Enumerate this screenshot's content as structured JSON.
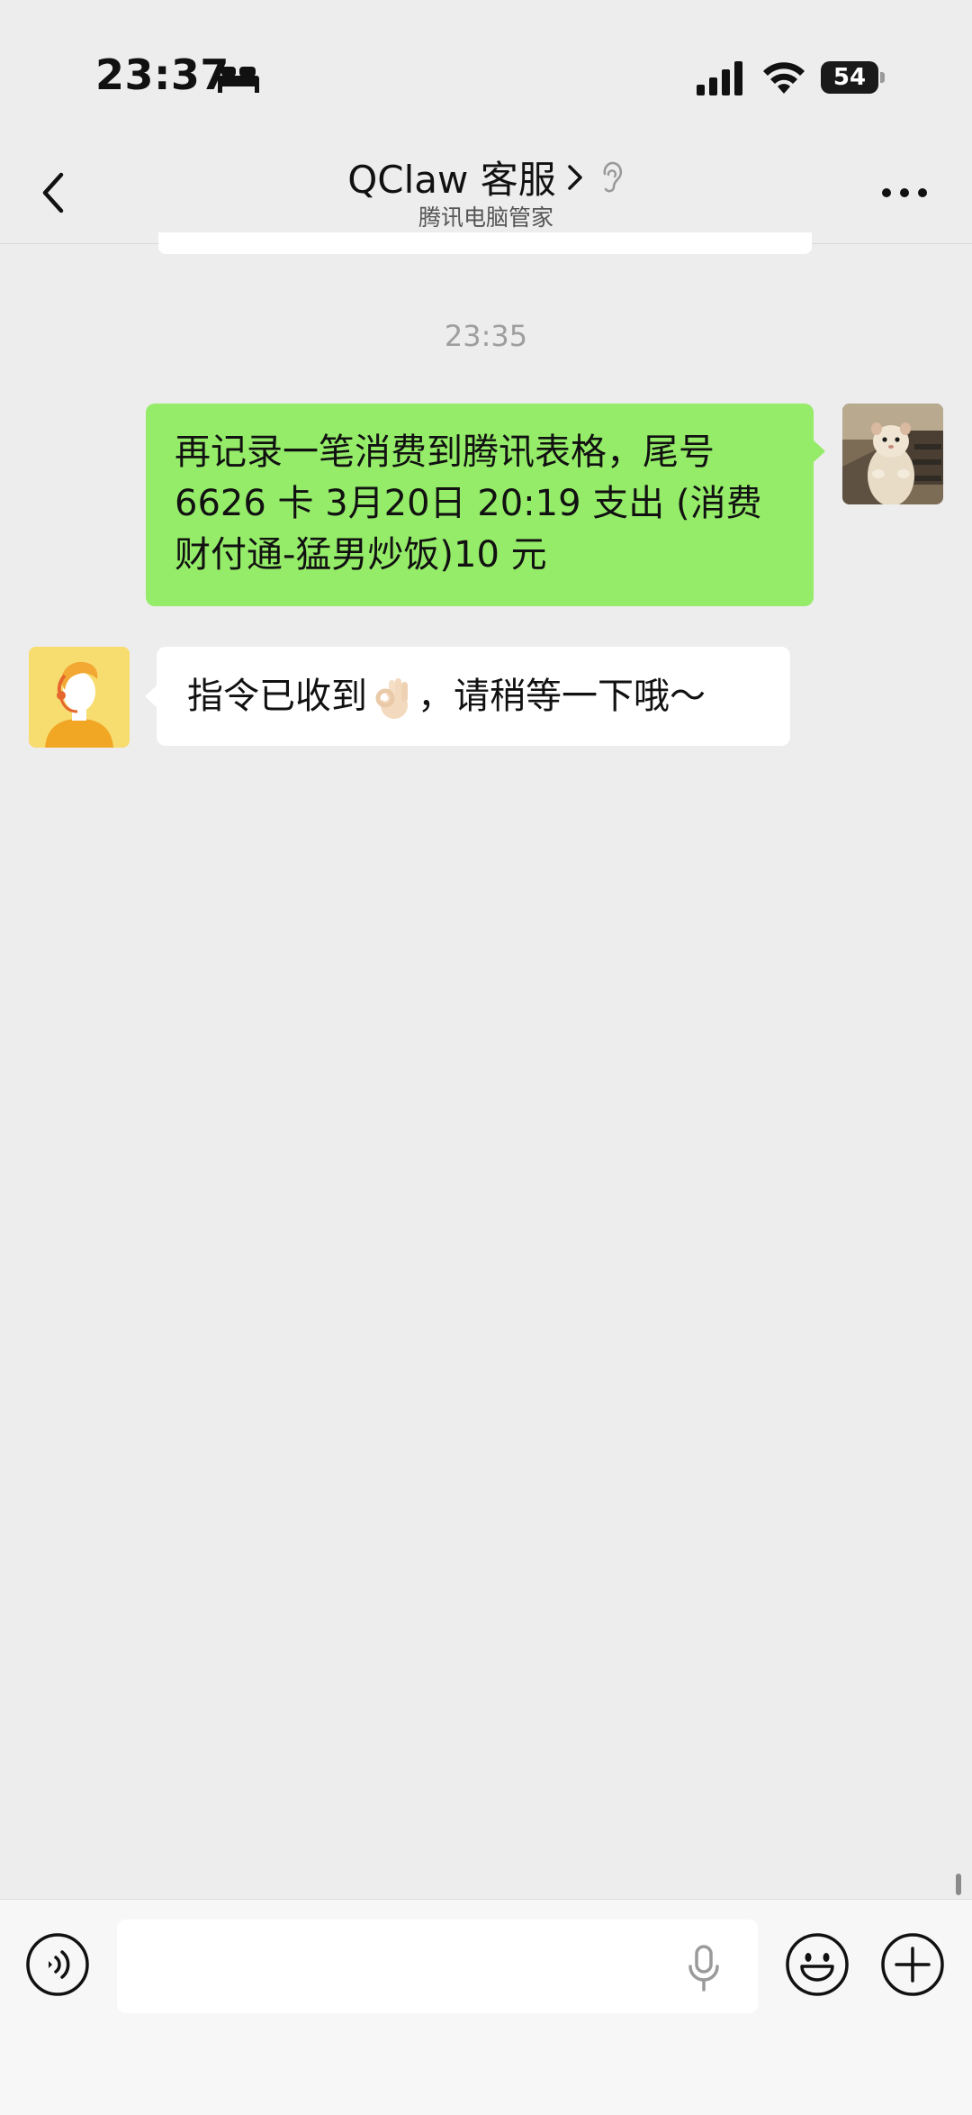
{
  "status_bar": {
    "time": "23:37",
    "battery": "54",
    "sleep_icon": "bed-icon",
    "signal_icon": "cellular-signal-icon",
    "wifi_icon": "wifi-icon"
  },
  "nav": {
    "title": "QClaw 客服",
    "subtitle": "腾讯电脑管家",
    "back_icon": "chevron-left-icon",
    "title_chevron_icon": "chevron-right-icon",
    "ear_icon": "ear-icon",
    "more_icon": "more-dots-icon"
  },
  "chat": {
    "timestamp": "23:35",
    "messages": [
      {
        "sender": "self",
        "text": "再记录一笔消费到腾讯表格，尾号6626 卡 3月20日 20:19 支出 (消费财付通-猛男炒饭)10 元"
      },
      {
        "sender": "bot",
        "text_before": "指令已收到",
        "emoji": "ok-hand-emoji",
        "text_after": "，请稍等一下哦～"
      }
    ]
  },
  "input_bar": {
    "value": "",
    "voice_icon": "voice-mode-icon",
    "mic_icon": "microphone-icon",
    "emoji_icon": "emoji-icon",
    "plus_icon": "plus-icon"
  },
  "colors": {
    "background": "#ededed",
    "outgoing_bubble": "#95ec69",
    "incoming_bubble": "#ffffff",
    "timestamp": "#9e9e9e"
  }
}
